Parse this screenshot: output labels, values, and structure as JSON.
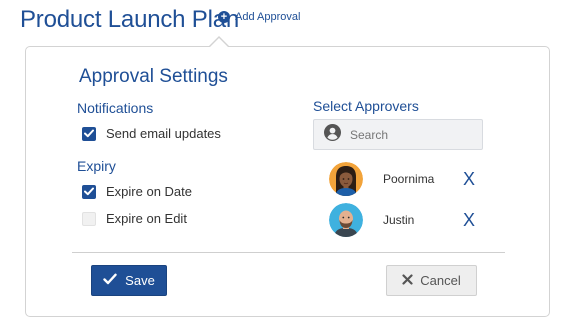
{
  "header": {
    "title": "Product Launch Plan",
    "add_approval_label": "Add Approval",
    "add_approval_icon": "plus-circle-icon"
  },
  "panel": {
    "title": "Approval Settings",
    "notifications": {
      "label": "Notifications",
      "options": [
        {
          "label": "Send email updates",
          "checked": true
        }
      ]
    },
    "expiry": {
      "label": "Expiry",
      "options": [
        {
          "label": "Expire on Date",
          "checked": true
        },
        {
          "label": "Expire on Edit",
          "checked": false
        }
      ]
    },
    "approvers": {
      "label": "Select Approvers",
      "search_placeholder": "Search",
      "search_value": "",
      "list": [
        {
          "name": "Poornima",
          "remove_label": "X"
        },
        {
          "name": "Justin",
          "remove_label": "X"
        }
      ]
    },
    "actions": {
      "save_label": "Save",
      "cancel_label": "Cancel"
    }
  },
  "colors": {
    "accent": "#1f4f96",
    "checkbox_unchecked": "#f1f1f1",
    "cancel_bg": "#eeeeee"
  }
}
